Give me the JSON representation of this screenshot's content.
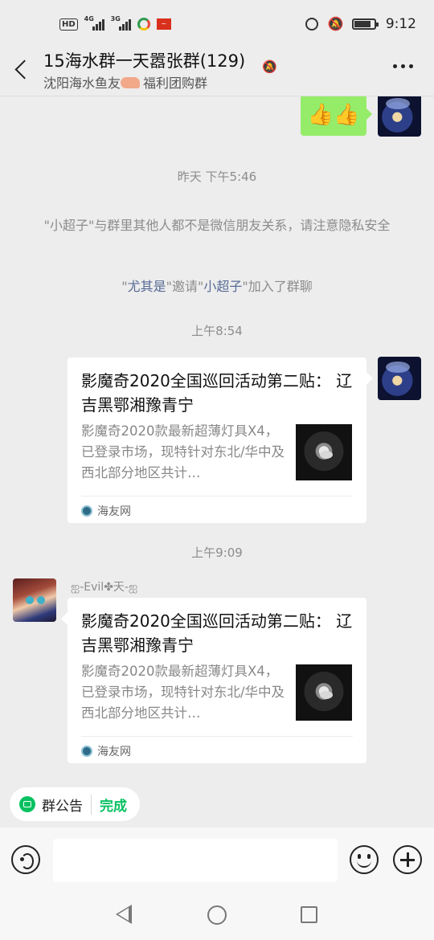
{
  "status_bar": {
    "network_badge": "HD",
    "sig1": "4G",
    "sig2": "3G",
    "time": "9:12"
  },
  "header": {
    "title": "15海水群一天嚣张群(129)",
    "subtitle_prefix": "沈阳海水鱼友",
    "subtitle_suffix": "福利团购群"
  },
  "messages": {
    "my_reaction": "👍👍",
    "ts1": "昨天 下午5:46",
    "notice_name": "\"小超子\"",
    "notice_text": "与群里其他人都不是微信朋友关系，请注意隐私安全",
    "invite_by": "尤其是",
    "invite_mid": "\"邀请\"",
    "invite_target": "小超子",
    "invite_end": "\"加入了群聊",
    "invite_open": "\"",
    "invite_close": "\"",
    "ts2": "上午8:54",
    "ts3": "上午9:09",
    "sender_name": "ஐ-Evil✤天-ஐ"
  },
  "cards": [
    {
      "title": "影魔奇2020全国巡回活动第二贴： 辽吉黑鄂湘豫青宁",
      "desc": "影魔奇2020款最新超薄灯具X4，已登录市场，现特针对东北/华中及西北部分地区共计…",
      "source": "海友网"
    },
    {
      "title": "影魔奇2020全国巡回活动第二贴： 辽吉黑鄂湘豫青宁",
      "desc": "影魔奇2020款最新超薄灯具X4，已登录市场，现特针对东北/华中及西北部分地区共计…",
      "source": "海友网"
    }
  ],
  "announcement": {
    "label": "群公告",
    "done": "完成"
  },
  "colors": {
    "background": "#ededed",
    "bubble_green": "#95ec69",
    "accent_green": "#07c160",
    "name_blue": "#576b95"
  },
  "icons": [
    "back-arrow-icon",
    "bell-off-icon",
    "more-icon",
    "voice-icon",
    "emoji-icon",
    "plus-icon"
  ]
}
